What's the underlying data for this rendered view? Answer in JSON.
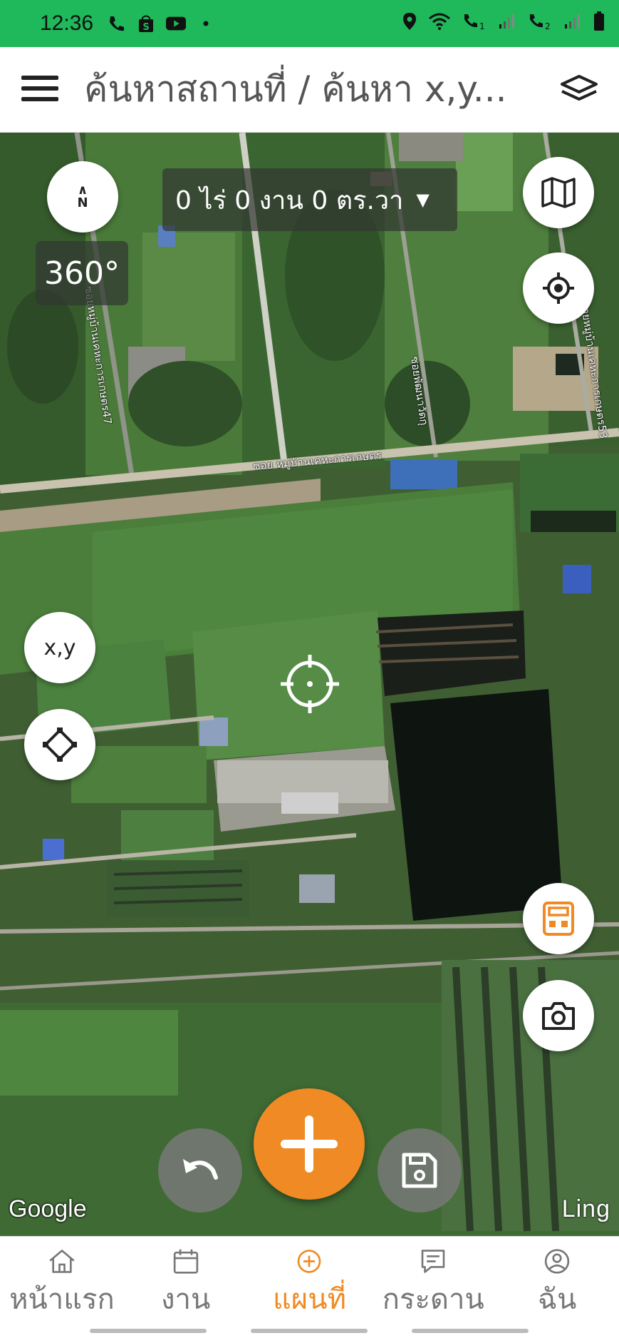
{
  "status_bar": {
    "time": "12:36",
    "left_icons": [
      "call-icon",
      "store-icon",
      "youtube-icon",
      "dot-icon"
    ],
    "right_icons": [
      "location-icon",
      "wifi-icon",
      "volte1-icon",
      "signal1-icon",
      "volte2-icon",
      "signal2-icon",
      "battery-icon"
    ],
    "background": "#1FB85A"
  },
  "app_bar": {
    "title": "ค้นหาสถานที่ / ค้นหา x,y...",
    "menu_icon": "menu-icon",
    "layers_icon": "layers-icon"
  },
  "map": {
    "compass_label": "N",
    "area_text": "0 ไร่ 0 งาน 0 ตร.วา",
    "degree_label": "360°",
    "xy_label": "x,y",
    "road_labels": [
      "ซอย หมู่บ้านเคหะการเกษตร",
      "ซอยหมู่บ้านเคหะการเกษตร47",
      "ซอยพัฒนาวัดกุ",
      "ซอยหมู่บ้านเคหะการเกษตร53"
    ],
    "attribution_left": "Google",
    "attribution_right": "Ling",
    "accent": "#F08A24"
  },
  "bottom_nav": {
    "items": [
      {
        "label": "หน้าแรก",
        "icon": "home-icon"
      },
      {
        "label": "งาน",
        "icon": "calendar-icon"
      },
      {
        "label": "แผนที่",
        "icon": "map-add-icon"
      },
      {
        "label": "กระดาน",
        "icon": "board-icon"
      },
      {
        "label": "ฉัน",
        "icon": "profile-icon"
      }
    ],
    "active_index": 2
  }
}
